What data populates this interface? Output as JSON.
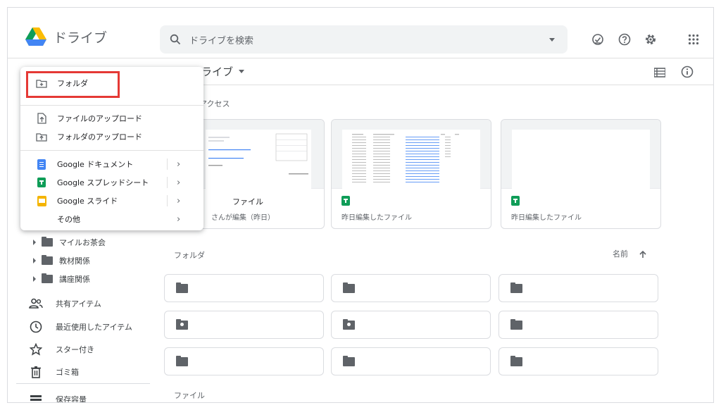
{
  "header": {
    "app_name": "ドライブ",
    "search_placeholder": "ドライブを検索"
  },
  "main": {
    "title": "ドライブ",
    "quick_access_label": "クイック アクセス",
    "quick_access_label_visible": "アクセス",
    "cards": [
      {
        "title": "ファイル",
        "subtitle": "さんが編集（昨日）"
      },
      {
        "title": "",
        "subtitle": "昨日編集したファイル"
      },
      {
        "title": "",
        "subtitle": "昨日編集したファイル"
      }
    ],
    "folders_label": "フォルダ",
    "sort_label": "名前",
    "files_label": "ファイル"
  },
  "nav": {
    "tree": [
      "マイルお茶会",
      "教材関係",
      "講座関係"
    ],
    "items": [
      "共有アイテム",
      "最近使用したアイテム",
      "スター付き",
      "ゴミ箱",
      "保存容量"
    ]
  },
  "menu": {
    "items": [
      {
        "label": "フォルダ"
      },
      {
        "label": "ファイルのアップロード"
      },
      {
        "label": "フォルダのアップロード"
      },
      {
        "label": "Google ドキュメント"
      },
      {
        "label": "Google スプレッドシート"
      },
      {
        "label": "Google スライド"
      },
      {
        "label": "その他"
      }
    ],
    "highlight_color": "#e53935"
  },
  "colors": {
    "docs": "#4285f4",
    "sheets": "#0f9d58",
    "slides": "#f4b400"
  }
}
